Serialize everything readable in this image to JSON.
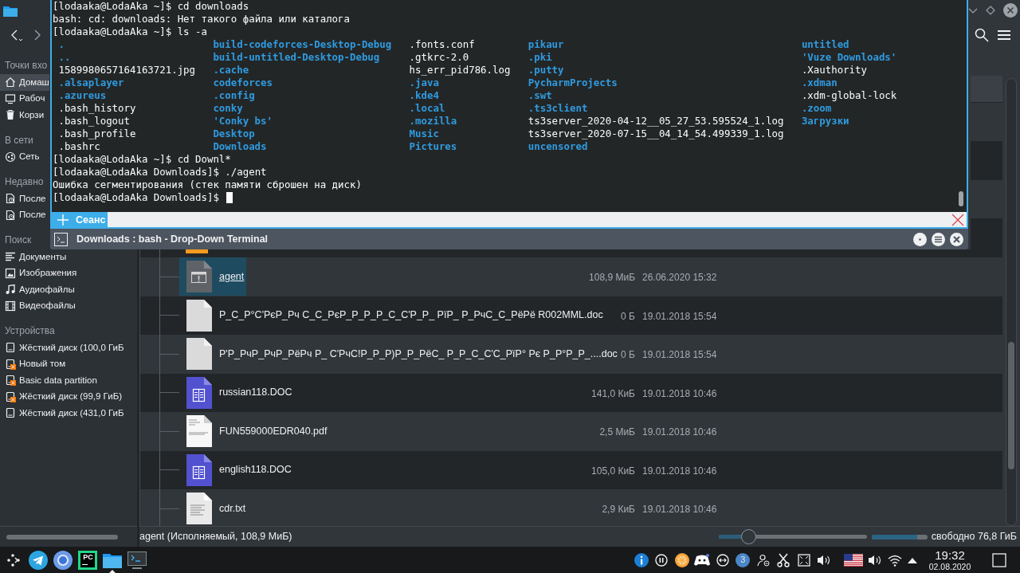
{
  "terminal": {
    "output_before": [
      "[lodaaka@LodaAka ~]$ cd downloads",
      "bash: cd: downloads: Нет такого файла или каталога",
      "[lodaaka@LodaAka ~]$ ls -a"
    ],
    "listing": [
      [
        {
          "name": ".",
          "kind": "dir"
        },
        {
          "name": "..",
          "kind": "dir"
        },
        {
          "name": "1589980657164163721.jpg",
          "kind": "file"
        },
        {
          "name": ".alsaplayer",
          "kind": "dir"
        },
        {
          "name": ".azureus",
          "kind": "dir"
        },
        {
          "name": ".bash_history",
          "kind": "file"
        },
        {
          "name": ".bash_logout",
          "kind": "file"
        },
        {
          "name": ".bash_profile",
          "kind": "file"
        },
        {
          "name": ".bashrc",
          "kind": "file"
        }
      ],
      [
        {
          "name": "build-codeforces-Desktop-Debug",
          "kind": "dir"
        },
        {
          "name": "build-untitled-Desktop-Debug",
          "kind": "dir"
        },
        {
          "name": ".cache",
          "kind": "dir"
        },
        {
          "name": "codeforces",
          "kind": "dir"
        },
        {
          "name": ".config",
          "kind": "dir"
        },
        {
          "name": "conky",
          "kind": "dir"
        },
        {
          "name": "'Conky bs'",
          "kind": "dir"
        },
        {
          "name": "Desktop",
          "kind": "dir"
        },
        {
          "name": "Downloads",
          "kind": "dir"
        }
      ],
      [
        {
          "name": ".fonts.conf",
          "kind": "file"
        },
        {
          "name": ".gtkrc-2.0",
          "kind": "file"
        },
        {
          "name": "hs_err_pid786.log",
          "kind": "file"
        },
        {
          "name": ".java",
          "kind": "dir"
        },
        {
          "name": ".kde4",
          "kind": "dir"
        },
        {
          "name": ".local",
          "kind": "dir"
        },
        {
          "name": ".mozilla",
          "kind": "dir"
        },
        {
          "name": "Music",
          "kind": "dir"
        },
        {
          "name": "Pictures",
          "kind": "dir"
        }
      ],
      [
        {
          "name": "pikaur",
          "kind": "dir"
        },
        {
          "name": ".pki",
          "kind": "dir"
        },
        {
          "name": ".putty",
          "kind": "dir"
        },
        {
          "name": "PycharmProjects",
          "kind": "dir"
        },
        {
          "name": ".swt",
          "kind": "dir"
        },
        {
          "name": ".ts3client",
          "kind": "dir"
        },
        {
          "name": "ts3server_2020-04-12__05_27_53.595524_1.log",
          "kind": "file"
        },
        {
          "name": "ts3server_2020-07-15__04_14_54.499339_1.log",
          "kind": "file"
        },
        {
          "name": "uncensored",
          "kind": "dir"
        }
      ],
      [
        {
          "name": "untitled",
          "kind": "dir"
        },
        {
          "name": "'Vuze Downloads'",
          "kind": "dir"
        },
        {
          "name": ".Xauthority",
          "kind": "file"
        },
        {
          "name": ".xdman",
          "kind": "dir"
        },
        {
          "name": ".xdm-global-lock",
          "kind": "file"
        },
        {
          "name": ".zoom",
          "kind": "dir"
        },
        {
          "name": "Загрузки",
          "kind": "dir"
        }
      ]
    ],
    "output_after": [
      "[lodaaka@LodaAka ~]$ cd Downl*",
      "[lodaaka@LodaAka Downloads]$ ./agent",
      "Ошибка сегментирования (стек памяти сброшен на диск)",
      "[lodaaka@LodaAka Downloads]$"
    ],
    "tabs": [
      {
        "label": "Сеанс",
        "selected": true
      }
    ],
    "title": "Downloads : bash - Drop-Down Terminal"
  },
  "sidebar": {
    "sections": [
      {
        "heading": "Точки вхо",
        "items": [
          {
            "label": "Домаш",
            "kind": "home",
            "selected": true
          },
          {
            "label": "Рабоч",
            "kind": "desktop",
            "selected": false
          },
          {
            "label": "Корзи",
            "kind": "trash",
            "selected": false
          }
        ]
      },
      {
        "heading": "В сети",
        "items": [
          {
            "label": "Сеть",
            "kind": "network",
            "selected": false
          }
        ]
      },
      {
        "heading": "Недавно",
        "items": [
          {
            "label": "После",
            "kind": "recent",
            "selected": false
          },
          {
            "label": "После",
            "kind": "recent",
            "selected": false
          }
        ]
      },
      {
        "heading": "Поиск",
        "items": [
          {
            "label": "Документы",
            "kind": "documents",
            "selected": false
          },
          {
            "label": "Изображения",
            "kind": "images",
            "selected": false
          },
          {
            "label": "Аудиофайлы",
            "kind": "audio",
            "selected": false
          },
          {
            "label": "Видеофайлы",
            "kind": "video",
            "selected": false
          }
        ]
      },
      {
        "heading": "Устройства",
        "items": [
          {
            "label": "Жёсткий диск (100,0 ГиБ",
            "kind": "drive",
            "selected": false,
            "mounted": true
          },
          {
            "label": "Новый том",
            "kind": "drive",
            "selected": false,
            "mounted": false
          },
          {
            "label": "Basic data partition",
            "kind": "drive",
            "selected": false,
            "mounted": false
          },
          {
            "label": "Жёсткий диск (99,9 ГиБ)",
            "kind": "drive",
            "selected": false,
            "mounted": false
          },
          {
            "label": "Жёсткий диск (431,0 ГиБ",
            "kind": "drive",
            "selected": false,
            "mounted": true
          }
        ]
      }
    ]
  },
  "files": [
    {
      "name": "agent",
      "size": "108,9 МиБ",
      "modified": "26.06.2020 15:32",
      "kind": "executable",
      "selected": true
    },
    {
      "name": "Р_С_Р°С'РєР_Рч С_С_РєР_Р_Р_Р_С_С'Р_Р_ РїР_ Р_РчС_С_РёРё R002MML.doc",
      "size": "0 Б",
      "modified": "19.01.2018 15:54",
      "kind": "blank",
      "selected": false
    },
    {
      "name": "Р'Р_РчР_РчР_РёРч Р_ С'РчС!Р_Р_Р)Р_Р_РёС_ Р_Р_С_С'С_РїР° Рє Р_Р°Р_Р_....doc",
      "size": "0 Б",
      "modified": "19.01.2018 15:54",
      "kind": "blank",
      "selected": false
    },
    {
      "name": "russian118.DOC",
      "size": "141,0 КиБ",
      "modified": "19.01.2018 10:46",
      "kind": "word",
      "selected": false
    },
    {
      "name": "FUN559000EDR040.pdf",
      "size": "2,5 МиБ",
      "modified": "19.01.2018 10:46",
      "kind": "pdf",
      "selected": false
    },
    {
      "name": "english118.DOC",
      "size": "105,0 КиБ",
      "modified": "19.01.2018 10:46",
      "kind": "word",
      "selected": false
    },
    {
      "name": "cdr.txt",
      "size": "2,9 КиБ",
      "modified": "19.01.2018 10:46",
      "kind": "text",
      "selected": false
    }
  ],
  "status_bar": {
    "text": "agent (Исполняемый, 108,9 МиБ)",
    "zoom_slider": {
      "level": 0.2
    },
    "disk_usage": {
      "level": 0.82
    },
    "free_space": "свободно 76,8 ГиБ"
  },
  "taskbar": {
    "apps": [
      {
        "kind": "launcher",
        "active": false
      },
      {
        "kind": "messenger",
        "active": false
      },
      {
        "kind": "browser",
        "active": false
      },
      {
        "kind": "ide",
        "label": "PC",
        "active": false
      },
      {
        "kind": "files",
        "active": true
      },
      {
        "kind": "terminal",
        "active": false
      }
    ],
    "tray": [
      {
        "kind": "info"
      },
      {
        "kind": "pause"
      },
      {
        "kind": "orange"
      },
      {
        "kind": "gamepad"
      },
      {
        "kind": "arrows"
      },
      {
        "kind": "count",
        "count": "3"
      },
      {
        "kind": "user"
      },
      {
        "kind": "scissors"
      },
      {
        "kind": "screen"
      },
      {
        "kind": "volume"
      },
      {
        "kind": "flag"
      },
      {
        "kind": "volume"
      },
      {
        "kind": "wifi"
      },
      {
        "kind": "expand"
      }
    ],
    "time": "19:32",
    "date": "02.08.2020"
  }
}
